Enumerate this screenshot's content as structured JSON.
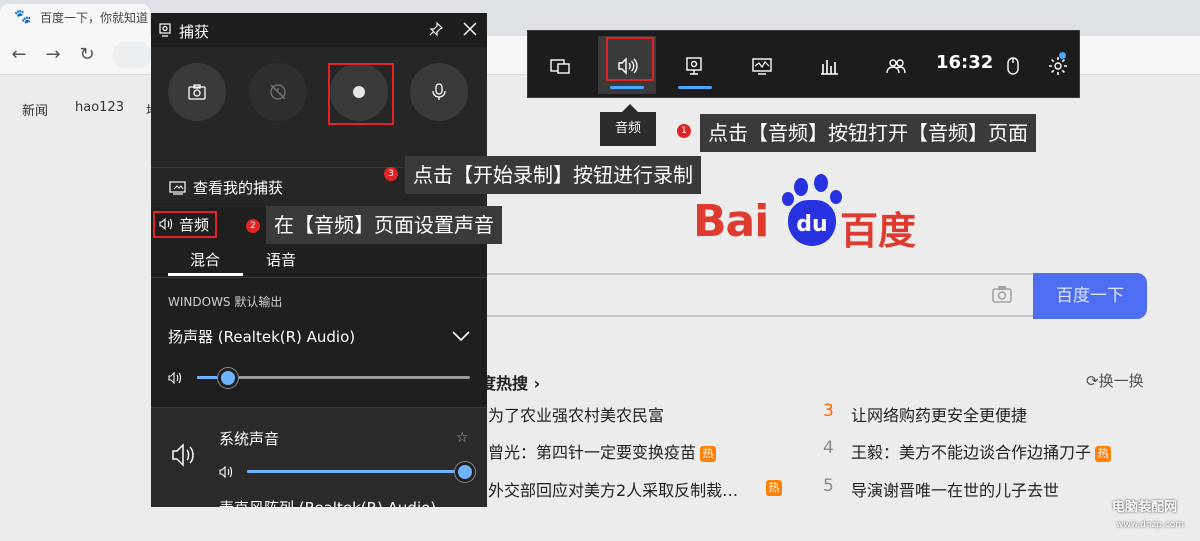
{
  "browser": {
    "tab_title": "百度一下，你就知道",
    "top_links": [
      "新闻",
      "hao123",
      "地"
    ]
  },
  "baidu": {
    "logo_latin": "Bai",
    "logo_du": "du",
    "logo_cn": "百度",
    "search_button": "百度一下",
    "hot_title": "度热搜",
    "hot_refresh": "换一换",
    "hot_left": [
      {
        "text": "为了农业强农村美农民富",
        "hot": false
      },
      {
        "text": "曾光：第四针一定要变换疫苗",
        "hot": true
      },
      {
        "text": "外交部回应对美方2人采取反制裁…",
        "hot": true
      }
    ],
    "hot_right": [
      {
        "num": "3",
        "text": "让网络购药更安全更便捷",
        "hot": false
      },
      {
        "num": "4",
        "text": "王毅：美方不能边谈合作边捅刀子",
        "hot": true
      },
      {
        "num": "5",
        "text": "导演谢晋唯一在世的儿子去世",
        "hot": false
      }
    ],
    "hot_badge": "热"
  },
  "xbox_bar": {
    "time": "16:32",
    "tooltip": "音频",
    "icons": [
      "widget-icon",
      "audio-icon",
      "capture-icon",
      "performance-icon",
      "resources-icon",
      "social-icon",
      "mouse-icon",
      "settings-icon"
    ]
  },
  "capture_panel": {
    "title": "捕获",
    "see_captures": "查看我的捕获",
    "audio_heading": "音频",
    "tabs": [
      "混合",
      "语音"
    ],
    "output_label": "WINDOWS 默认输出",
    "device": "扬声器 (Realtek(R) Audio)",
    "master_volume": 0.08,
    "system_sound_label": "系统声音",
    "system_volume": 1.0,
    "next_device_partial": "麦克风阵列 (Realtek(R) Audio)"
  },
  "callouts": {
    "one": {
      "num": "1",
      "text": "点击【音频】按钮打开【音频】页面"
    },
    "two": {
      "num": "2",
      "text": "在【音频】页面设置声音"
    },
    "three": {
      "num": "3",
      "text": "点击【开始录制】按钮进行录制"
    }
  },
  "watermark": {
    "main": "电脑装配网",
    "sub": "www.dnzp.com"
  },
  "colors": {
    "accent": "#4ca6ff",
    "annotation_red": "#e02323",
    "baidu_blue": "#2932e1",
    "baidu_red": "#de3a2f",
    "hot_orange": "#ff8105"
  }
}
